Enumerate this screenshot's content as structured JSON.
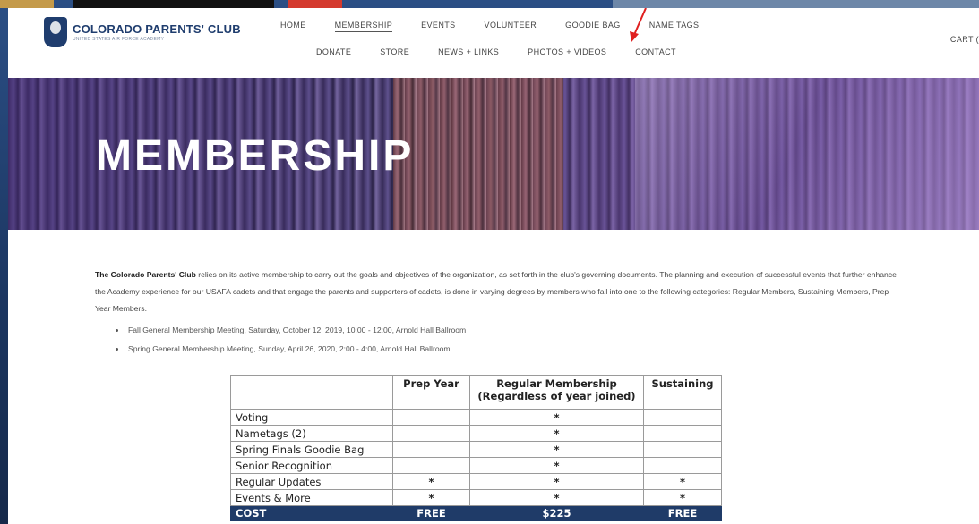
{
  "brand": {
    "title": "COLORADO PARENTS' CLUB",
    "subtitle": "UNITED STATES AIR FORCE ACADEMY",
    "logo_icon": "falcon-crest-icon"
  },
  "nav": {
    "row1": [
      "HOME",
      "MEMBERSHIP",
      "EVENTS",
      "VOLUNTEER",
      "GOODIE BAG",
      "NAME TAGS"
    ],
    "row2": [
      "DONATE",
      "STORE",
      "NEWS + LINKS",
      "PHOTOS + VIDEOS",
      "CONTACT"
    ],
    "active": "MEMBERSHIP",
    "cart": "CART ("
  },
  "hero": {
    "title": "MEMBERSHIP"
  },
  "intro": {
    "org_name": "The Colorado Parents' Club",
    "text": " relies on its active membership to carry out the goals and objectives of the organization, as set forth in the club's governing documents.  The planning and execution of successful events that further enhance the Academy experience for our USAFA cadets and that engage the parents and supporters of cadets, is done in varying degrees by members who fall into one to the following categories: Regular Members, Sustaining Members, Prep Year Members."
  },
  "meetings": [
    "Fall General Membership Meeting, Saturday, October 12, 2019, 10:00 - 12:00, Arnold Hall Ballroom",
    "Spring General Membership Meeting, Sunday, April 26, 2020, 2:00 - 4:00, Arnold Hall Ballroom"
  ],
  "table": {
    "headers": [
      "",
      "Prep Year",
      "Regular Membership (Regardless of year joined)",
      "Sustaining"
    ],
    "rows": [
      [
        "Voting",
        "",
        "*",
        ""
      ],
      [
        "Nametags (2)",
        "",
        "*",
        ""
      ],
      [
        "Spring Finals Goodie Bag",
        "",
        "*",
        ""
      ],
      [
        "Senior Recognition",
        "",
        "*",
        ""
      ],
      [
        "Regular Updates",
        "*",
        "*",
        "*"
      ],
      [
        "Events & More",
        "*",
        "*",
        "*"
      ]
    ],
    "cost": [
      "COST",
      "FREE",
      "$225",
      "FREE"
    ]
  },
  "colors": {
    "brand_navy": "#1f3d6e",
    "cost_row": "#1f3b68",
    "annotation_arrow": "#e02020"
  }
}
